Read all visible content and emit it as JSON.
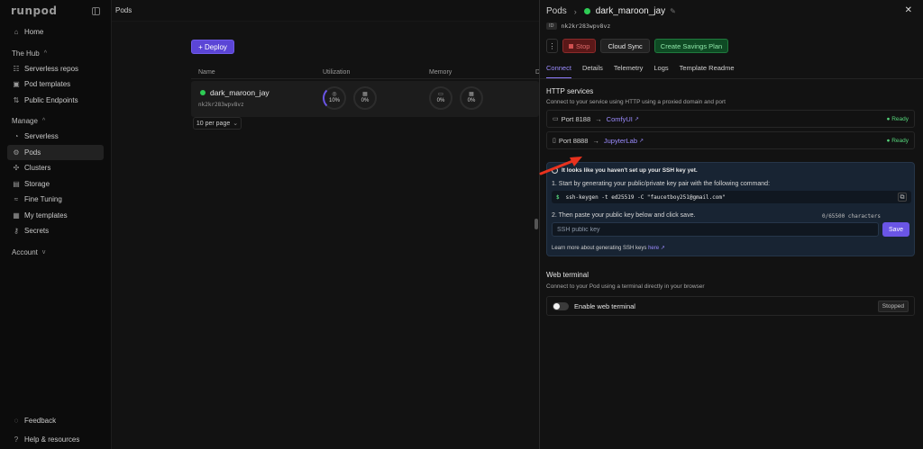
{
  "sidebar": {
    "brand": "runpod",
    "items_top": [
      {
        "label": "Home",
        "icon": "home-icon"
      }
    ],
    "hub_header": "The Hub",
    "hub_items": [
      {
        "label": "Serverless repos",
        "icon": "repos-icon"
      },
      {
        "label": "Pod templates",
        "icon": "templates-icon"
      },
      {
        "label": "Public Endpoints",
        "icon": "endpoints-icon"
      }
    ],
    "manage_header": "Manage",
    "manage_items": [
      {
        "label": "Serverless",
        "icon": "serverless-icon"
      },
      {
        "label": "Pods",
        "icon": "pods-icon",
        "active": true
      },
      {
        "label": "Clusters",
        "icon": "clusters-icon"
      },
      {
        "label": "Storage",
        "icon": "storage-icon"
      },
      {
        "label": "Fine Tuning",
        "icon": "fine-tuning-icon"
      },
      {
        "label": "My templates",
        "icon": "my-templates-icon"
      },
      {
        "label": "Secrets",
        "icon": "secrets-icon"
      }
    ],
    "account_header": "Account",
    "bottom_items": [
      {
        "label": "Feedback",
        "icon": "feedback-icon"
      },
      {
        "label": "Help & resources",
        "icon": "help-icon"
      }
    ]
  },
  "topbar": {
    "title": "Pods"
  },
  "main": {
    "deploy_label": "+ Deploy",
    "columns": [
      "Name",
      "Utilization",
      "Memory",
      "D"
    ],
    "pod": {
      "name": "dark_maroon_jay",
      "id": "nk2kr283wpv8vz",
      "gauges": [
        {
          "icon": "cpu-icon",
          "value": "10%"
        },
        {
          "icon": "gpu-icon",
          "value": "0%"
        },
        {
          "icon": "memory-icon",
          "value": "0%"
        },
        {
          "icon": "vram-icon",
          "value": "0%"
        }
      ]
    },
    "per_page": "10 per page"
  },
  "panel": {
    "breadcrumb_root": "Pods",
    "pod_name": "dark_maroon_jay",
    "id_label": "ID",
    "id_value": "nk2kr283wpv8vz",
    "actions": {
      "stop": "Stop",
      "sync": "Cloud Sync",
      "savings": "Create Savings Plan"
    },
    "tabs": [
      "Connect",
      "Details",
      "Telemetry",
      "Logs",
      "Template Readme"
    ],
    "http_title": "HTTP services",
    "http_desc": "Connect to your service using HTTP using a proxied domain and port",
    "services": [
      {
        "port": "Port 8188",
        "name": "ComfyUI",
        "status": "Ready"
      },
      {
        "port": "Port 8888",
        "name": "JupyterLab",
        "status": "Ready"
      }
    ],
    "ssh": {
      "warning": "It looks like you haven't set up your SSH key yet.",
      "step1": "1. Start by generating your public/private key pair with the following command:",
      "prompt": "$",
      "command": "ssh-keygen -t ed25519 -C \"faucetboy251@gmail.com\"",
      "step2": "2. Then paste your public key below and click save.",
      "char_count": "0/65500 characters",
      "placeholder": "SSH public key",
      "save": "Save",
      "learn_text": "Learn more about generating SSH keys",
      "learn_link": "here"
    },
    "terminal_title": "Web terminal",
    "terminal_desc": "Connect to your Pod using a terminal directly in your browser",
    "terminal_label": "Enable web terminal",
    "terminal_status": "Stopped"
  },
  "colors": {
    "accent": "#6a55e6",
    "ready": "#55d47a",
    "stop": "#d05050",
    "annotation_arrow": "#e8321e"
  }
}
